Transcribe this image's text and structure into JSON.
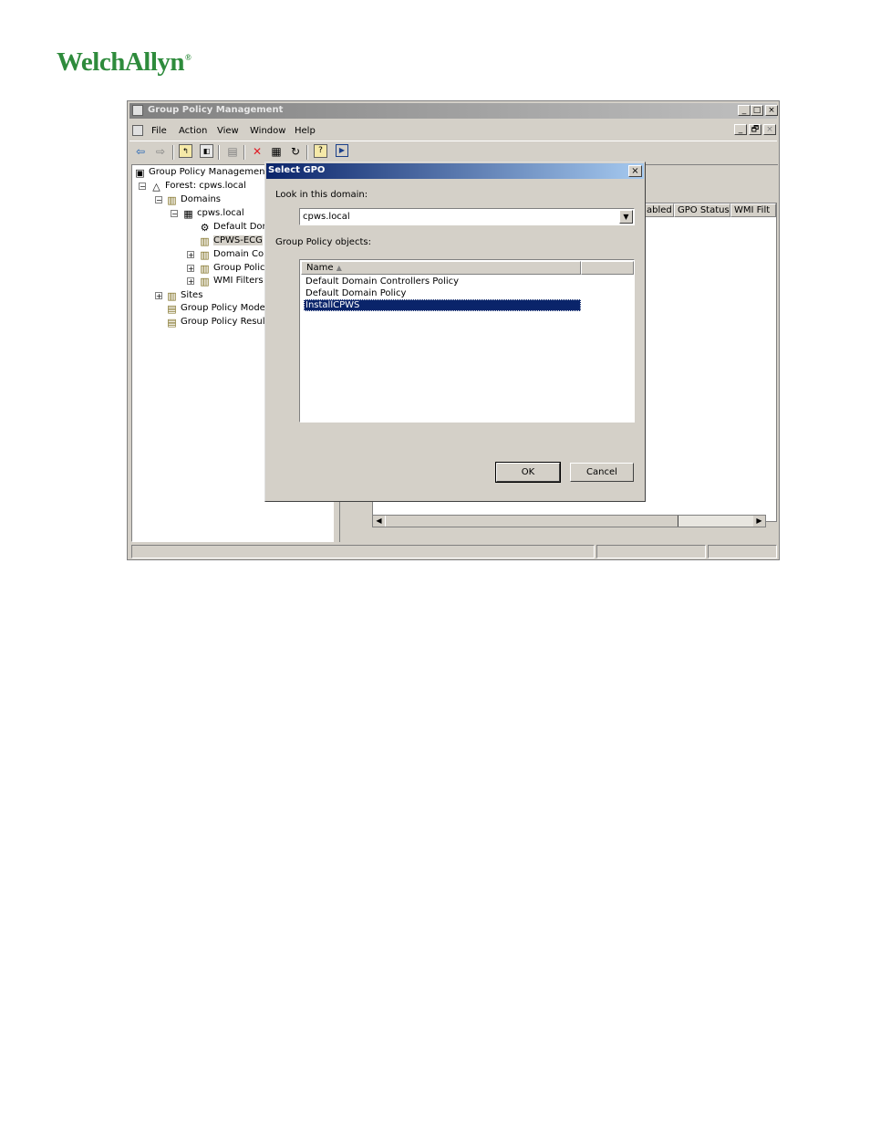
{
  "logo": {
    "text": "WelchAllyn",
    "registered": "®"
  },
  "window": {
    "title": "Group Policy Management",
    "menu": [
      "File",
      "Action",
      "View",
      "Window",
      "Help"
    ],
    "caption_buttons": {
      "minimize": "_",
      "maximize": "□",
      "close": "×",
      "restore": "🗗"
    }
  },
  "tree": {
    "root": "Group Policy Management",
    "forest": "Forest: cpws.local",
    "domains": "Domains",
    "domain": "cpws.local",
    "default_dom": "Default Dom",
    "cpws_ecg": "CPWS-ECG",
    "domain_con": "Domain Con",
    "group_policy": "Group Policy",
    "wmi_filters": "WMI Filters",
    "sites": "Sites",
    "gp_modeling": "Group Policy Modelir",
    "gp_results": "Group Policy Results"
  },
  "right_pane": {
    "columns": [
      "abled",
      "GPO Status",
      "WMI Filt"
    ]
  },
  "dialog": {
    "title": "Select GPO",
    "look_in_label": "Look in this domain:",
    "domain_value": "cpws.local",
    "gpo_label": "Group Policy objects:",
    "column_name": "Name",
    "items": [
      "Default Domain Controllers Policy",
      "Default Domain Policy",
      "InstallCPWS"
    ],
    "selected_index": 2,
    "ok_label": "OK",
    "cancel_label": "Cancel"
  }
}
